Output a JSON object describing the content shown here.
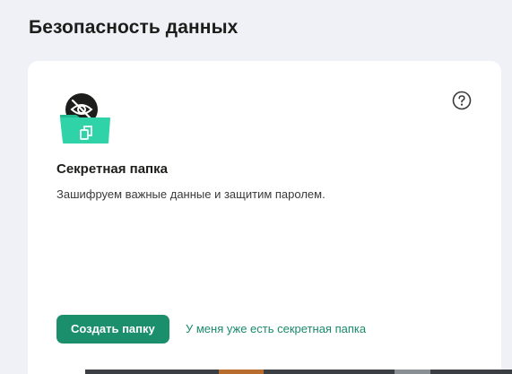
{
  "page": {
    "title": "Безопасность данных"
  },
  "card": {
    "icon": "secret-folder-icon",
    "help_icon": "question-circle-icon",
    "title": "Секретная папка",
    "description": "Зашифруем важные данные и защитим паролем.",
    "primary_button": "Создать папку",
    "secondary_link": "У меня уже есть секретная папка"
  },
  "colors": {
    "accent": "#1b8f6c",
    "link": "#1a8a6a",
    "folder": "#2fd3a7",
    "background": "#eff1f6",
    "card": "#ffffff",
    "text": "#1d1d1b"
  }
}
